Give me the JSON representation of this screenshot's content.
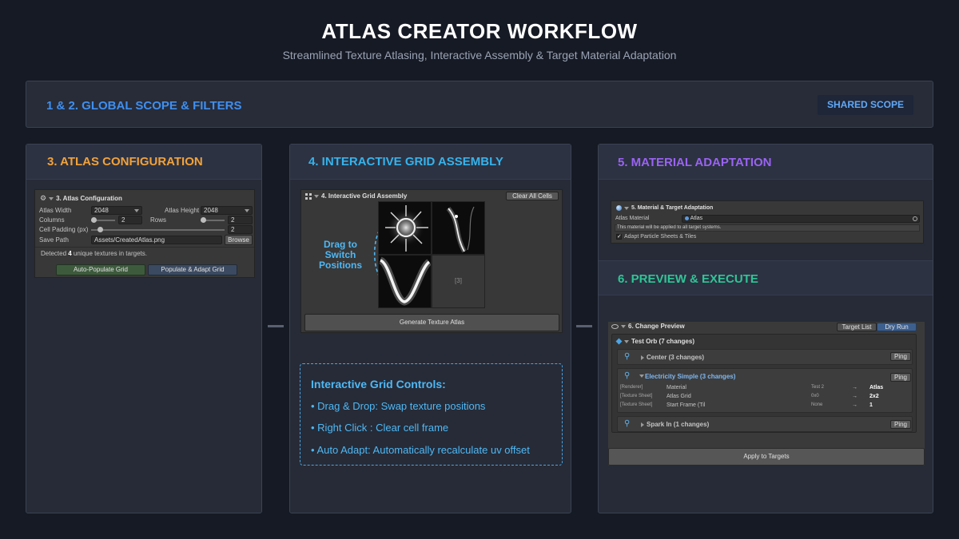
{
  "header": {
    "title": "ATLAS CREATOR WORKFLOW",
    "subtitle": "Streamlined Texture Atlasing, Interactive Assembly & Target Material Adaptation"
  },
  "global_scope": {
    "title": "1 & 2. GLOBAL SCOPE & FILTERS",
    "badge": "SHARED SCOPE"
  },
  "atlas_config": {
    "title": "3. ATLAS CONFIGURATION",
    "section_title": "3. Atlas Configuration",
    "atlas_width_label": "Atlas Width",
    "atlas_width_value": "2048",
    "atlas_height_label": "Atlas Height",
    "atlas_height_value": "2048",
    "columns_label": "Columns",
    "columns_value": "2",
    "rows_label": "Rows",
    "rows_value": "2",
    "cell_padding_label": "Cell Padding (px)",
    "cell_padding_value": "2",
    "save_path_label": "Save Path",
    "save_path_value": "Assets/CreatedAtlas.png",
    "browse_label": "Browse",
    "detected_prefix": "Detected ",
    "detected_count": "4",
    "detected_suffix": " unique textures in targets.",
    "auto_populate_label": "Auto-Populate Grid",
    "populate_adapt_label": "Populate & Adapt Grid",
    "columns_slider": 0.02,
    "rows_slider": 0.02,
    "padding_slider": 0.05
  },
  "grid_assembly": {
    "title": "4. INTERACTIVE GRID ASSEMBLY",
    "section_title": "4. Interactive Grid Assembly",
    "clear_all_label": "Clear All Cells",
    "drag_hint": "Drag to Switch Positions",
    "empty_cell_label": "[3]",
    "generate_label": "Generate Texture Atlas",
    "controls_title": "Interactive Grid Controls:",
    "controls": [
      "• Drag & Drop: Swap texture positions",
      "• Right Click : Clear cell frame",
      "• Auto Adapt: Automatically recalculate uv offset"
    ]
  },
  "material_adaptation": {
    "title": "5. MATERIAL ADAPTATION",
    "section_title": "5. Material & Target Adaptation",
    "atlas_material_label": "Atlas Material",
    "atlas_material_value": "Atlas",
    "info_text": "This material will be applied to all target systems.",
    "adapt_toggle_label": "Adapt Particle Sheets & Tiles",
    "adapt_toggle_checked": true
  },
  "preview": {
    "title": "6. PREVIEW & EXECUTE",
    "section_title": "6. Change Preview",
    "tab_target_list": "Target List",
    "tab_dry_run": "Dry Run",
    "root_label": "Test Orb (7 changes)",
    "ping_label": "Ping",
    "items": [
      {
        "label": "Center (3 changes)",
        "expanded": false
      },
      {
        "label": "Electricity Simple (3 changes)",
        "expanded": true
      },
      {
        "label": "Spark In (1 changes)",
        "expanded": false
      }
    ],
    "changes": [
      {
        "type": "[Renderer]",
        "property": "Material",
        "from": "Test 2",
        "arrow": "→",
        "to": "Atlas"
      },
      {
        "type": "[Texture Sheet]",
        "property": "Atlas Grid",
        "from": "0x0",
        "arrow": "→",
        "to": "2x2"
      },
      {
        "type": "[Texture Sheet]",
        "property": "Start Frame (Til",
        "from": "None",
        "arrow": "→",
        "to": "1"
      }
    ],
    "apply_label": "Apply to Targets"
  },
  "colors": {
    "global_title": "#3f8ff0",
    "atlas_title": "#f2a23a",
    "grid_title": "#36b3ec",
    "material_title": "#9a63f2",
    "preview_title": "#2fc596",
    "highlight_blue": "#4fb8f5"
  }
}
